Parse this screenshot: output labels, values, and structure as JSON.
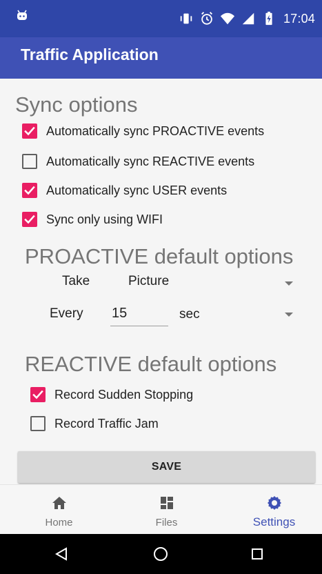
{
  "status_bar": {
    "time": "17:04",
    "left_icon": "android-debug-icon",
    "right_icons": [
      "vibrate-icon",
      "alarm-icon",
      "wifi-icon",
      "signal-icon",
      "battery-icon"
    ]
  },
  "app_bar": {
    "title": "Traffic Application",
    "background": "#3f51b5"
  },
  "sync_options": {
    "title": "Sync options",
    "items": [
      {
        "label": "Automatically sync PROACTIVE events",
        "checked": true
      },
      {
        "label": "Automatically sync REACTIVE events",
        "checked": false
      },
      {
        "label": "Automatically sync USER events",
        "checked": true
      },
      {
        "label": "Sync only using WIFI",
        "checked": true
      }
    ]
  },
  "proactive_defaults": {
    "title": "PROACTIVE default options",
    "take_label": "Take",
    "take_value": "Picture",
    "every_label": "Every",
    "every_value": "15",
    "unit_value": "sec"
  },
  "reactive_defaults": {
    "title": "REACTIVE default options",
    "items": [
      {
        "label": "Record Sudden Stopping",
        "checked": true
      },
      {
        "label": "Record Traffic Jam",
        "checked": false
      }
    ]
  },
  "save_button": {
    "label": "SAVE"
  },
  "bottom_nav": {
    "items": [
      {
        "label": "Home",
        "icon": "home-icon",
        "active": false
      },
      {
        "label": "Files",
        "icon": "files-icon",
        "active": false
      },
      {
        "label": "Settings",
        "icon": "settings-icon",
        "active": true
      }
    ]
  },
  "system_nav": {
    "icons": [
      "back-icon",
      "home-circle-icon",
      "recents-icon"
    ]
  },
  "colors": {
    "primary_dark": "#2f46a8",
    "primary": "#3f51b5",
    "accent": "#e91e63",
    "section_gray": "#757575",
    "button_gray": "#d8d8d8"
  }
}
